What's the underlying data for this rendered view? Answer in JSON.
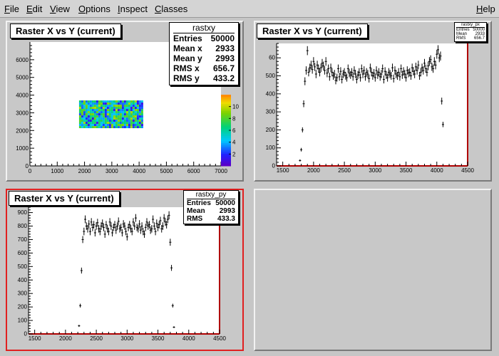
{
  "menu": [
    {
      "first": "F",
      "rest": "ile"
    },
    {
      "first": "E",
      "rest": "dit"
    },
    {
      "first": "V",
      "rest": "iew"
    },
    {
      "first": "O",
      "rest": "ptions"
    },
    {
      "first": "I",
      "rest": "nspect"
    },
    {
      "first": "C",
      "rest": "lasses"
    }
  ],
  "help": {
    "first": "H",
    "rest": "elp"
  },
  "colors": {
    "window_bg": "#c6c6c6",
    "active_border": "#e02020",
    "frame_line": "#b00000"
  },
  "chart_data": [
    {
      "type": "heatmap",
      "title": "Raster X vs Y (current)",
      "stats": {
        "name": "rastxy",
        "rows": [
          {
            "label": "Entries",
            "value": "50000"
          },
          {
            "label": "Mean x",
            "value": "2933"
          },
          {
            "label": "Mean y",
            "value": "2993"
          },
          {
            "label": "RMS x",
            "value": "656.7"
          },
          {
            "label": "RMS y",
            "value": "433.2"
          }
        ]
      },
      "xlim": [
        0,
        7000
      ],
      "ylim": [
        0,
        7000
      ],
      "x_ticks": [
        0,
        1000,
        2000,
        3000,
        4000,
        5000,
        6000,
        7000
      ],
      "y_ticks": [
        0,
        1000,
        2000,
        3000,
        4000,
        5000,
        6000
      ],
      "filled_region": {
        "x": [
          1800,
          4100
        ],
        "y": [
          2200,
          3700
        ]
      },
      "palette": "rainbow",
      "z_ticks": [
        2,
        4,
        6,
        8,
        10
      ],
      "z_max": 12
    },
    {
      "type": "scatter",
      "title": "Raster X vs Y (current)",
      "stats": {
        "name": "rastxy_px",
        "rows": [
          {
            "label": "Entries",
            "value": "50000"
          },
          {
            "label": "Mean",
            "value": "2933"
          },
          {
            "label": "RMS",
            "value": "656.7"
          }
        ]
      },
      "xlim": [
        1400,
        4500
      ],
      "ylim": [
        0,
        680
      ],
      "x_ticks": [
        1500,
        2000,
        2500,
        3000,
        3500,
        4000,
        4500
      ],
      "y_ticks": [
        0,
        100,
        200,
        300,
        400,
        500,
        600
      ],
      "y_tick_labels": [
        "0",
        "100",
        "200",
        "300",
        "400",
        "500",
        "60"
      ],
      "error_bars": true,
      "x": [
        1780,
        1800,
        1820,
        1840,
        1860,
        1880,
        1900,
        1920,
        1940,
        1960,
        1980,
        2000,
        2020,
        2040,
        2060,
        2080,
        2100,
        2120,
        2140,
        2160,
        2180,
        2200,
        2220,
        2240,
        2260,
        2280,
        2300,
        2320,
        2340,
        2360,
        2380,
        2400,
        2420,
        2440,
        2460,
        2480,
        2500,
        2520,
        2540,
        2560,
        2580,
        2600,
        2620,
        2640,
        2660,
        2680,
        2700,
        2720,
        2740,
        2760,
        2780,
        2800,
        2820,
        2840,
        2860,
        2880,
        2900,
        2920,
        2940,
        2960,
        2980,
        3000,
        3020,
        3040,
        3060,
        3080,
        3100,
        3120,
        3140,
        3160,
        3180,
        3200,
        3220,
        3240,
        3260,
        3280,
        3300,
        3320,
        3340,
        3360,
        3380,
        3400,
        3420,
        3440,
        3460,
        3480,
        3500,
        3520,
        3540,
        3560,
        3580,
        3600,
        3620,
        3640,
        3660,
        3680,
        3700,
        3720,
        3740,
        3760,
        3780,
        3800,
        3820,
        3840,
        3860,
        3880,
        3900,
        3920,
        3940,
        3960,
        3980,
        4000,
        4020,
        4040,
        4060,
        4080,
        4100
      ],
      "y": [
        30,
        90,
        200,
        345,
        470,
        530,
        640,
        520,
        545,
        560,
        535,
        580,
        550,
        510,
        560,
        540,
        520,
        545,
        570,
        555,
        530,
        580,
        515,
        540,
        495,
        545,
        520,
        500,
        510,
        475,
        490,
        540,
        495,
        525,
        480,
        510,
        520,
        500,
        490,
        540,
        515,
        505,
        520,
        495,
        530,
        510,
        480,
        505,
        520,
        490,
        540,
        510,
        530,
        495,
        520,
        510,
        485,
        545,
        520,
        500,
        515,
        490,
        530,
        505,
        520,
        495,
        510,
        540,
        480,
        525,
        505,
        490,
        520,
        510,
        500,
        545,
        485,
        530,
        510,
        500,
        520,
        495,
        540,
        505,
        525,
        510,
        490,
        530,
        515,
        520,
        500,
        545,
        525,
        510,
        550,
        530,
        560,
        500,
        520,
        545,
        530,
        570,
        540,
        520,
        555,
        580,
        590,
        550,
        540,
        580,
        560,
        620,
        645,
        600,
        610,
        360,
        230,
        130,
        35,
        10,
        3
      ],
      "y_err": [
        6,
        10,
        14,
        19,
        22,
        23,
        25,
        23,
        23,
        24,
        23,
        24,
        23,
        23,
        24,
        23,
        23,
        23,
        24,
        24,
        23,
        24,
        23,
        23,
        22,
        23,
        23,
        22,
        23,
        22,
        22,
        23,
        22,
        23,
        22,
        23,
        23,
        22,
        22,
        23,
        23,
        22,
        23,
        22,
        23,
        23,
        22,
        22,
        23,
        22,
        23,
        23,
        23,
        22,
        23,
        23,
        22,
        23,
        23,
        22,
        23,
        22,
        23,
        22,
        23,
        22,
        23,
        23,
        22,
        23,
        22,
        22,
        23,
        23,
        22,
        23,
        22,
        23,
        23,
        22,
        23,
        22,
        23,
        22,
        23,
        23,
        22,
        23,
        23,
        23,
        22,
        23,
        23,
        23,
        23,
        23,
        24,
        22,
        23,
        23,
        23,
        24,
        23,
        23,
        24,
        24,
        24,
        23,
        23,
        24,
        24,
        25,
        25,
        24,
        25,
        19,
        15,
        11,
        6,
        3,
        2
      ]
    },
    {
      "type": "scatter",
      "title": "Raster X vs Y (current)",
      "stats": {
        "name": "rastxy_py",
        "rows": [
          {
            "label": "Entries",
            "value": "50000"
          },
          {
            "label": "Mean",
            "value": "2993"
          },
          {
            "label": "RMS",
            "value": "433.3"
          }
        ]
      },
      "xlim": [
        1400,
        4500
      ],
      "ylim": [
        0,
        940
      ],
      "x_ticks": [
        1500,
        2000,
        2500,
        3000,
        3500,
        4000,
        4500
      ],
      "y_ticks": [
        0,
        100,
        200,
        300,
        400,
        500,
        600,
        700,
        800,
        900
      ],
      "error_bars": true,
      "x": [
        2220,
        2240,
        2260,
        2280,
        2300,
        2320,
        2340,
        2360,
        2380,
        2400,
        2420,
        2440,
        2460,
        2480,
        2500,
        2520,
        2540,
        2560,
        2580,
        2600,
        2620,
        2640,
        2660,
        2680,
        2700,
        2720,
        2740,
        2760,
        2780,
        2800,
        2820,
        2840,
        2860,
        2880,
        2900,
        2920,
        2940,
        2960,
        2980,
        3000,
        3020,
        3040,
        3060,
        3080,
        3100,
        3120,
        3140,
        3160,
        3180,
        3200,
        3220,
        3240,
        3260,
        3280,
        3300,
        3320,
        3340,
        3360,
        3380,
        3400,
        3420,
        3440,
        3460,
        3480,
        3500,
        3520,
        3540,
        3560,
        3580,
        3600,
        3620,
        3640,
        3660,
        3680,
        3700,
        3720,
        3740,
        3760
      ],
      "y": [
        60,
        210,
        470,
        700,
        760,
        850,
        800,
        780,
        815,
        760,
        830,
        790,
        810,
        750,
        800,
        825,
        780,
        760,
        800,
        820,
        790,
        740,
        810,
        780,
        760,
        830,
        800,
        750,
        790,
        810,
        770,
        800,
        835,
        780,
        790,
        750,
        815,
        800,
        760,
        720,
        790,
        810,
        780,
        760,
        830,
        800,
        860,
        790,
        780,
        815,
        770,
        800,
        760,
        740,
        790,
        830,
        800,
        810,
        770,
        780,
        850,
        800,
        760,
        820,
        790,
        810,
        840,
        780,
        800,
        860,
        830,
        810,
        850,
        880,
        680,
        490,
        210,
        50
      ],
      "y_err": [
        8,
        14,
        22,
        26,
        28,
        29,
        28,
        28,
        29,
        28,
        29,
        28,
        28,
        27,
        28,
        29,
        28,
        28,
        28,
        29,
        28,
        27,
        28,
        28,
        28,
        29,
        28,
        27,
        28,
        28,
        28,
        28,
        29,
        28,
        28,
        27,
        29,
        28,
        28,
        27,
        28,
        28,
        28,
        28,
        29,
        28,
        29,
        28,
        28,
        29,
        28,
        28,
        28,
        27,
        28,
        29,
        28,
        28,
        28,
        28,
        29,
        28,
        28,
        29,
        28,
        28,
        29,
        28,
        28,
        29,
        29,
        28,
        29,
        30,
        26,
        22,
        14,
        7
      ]
    }
  ]
}
